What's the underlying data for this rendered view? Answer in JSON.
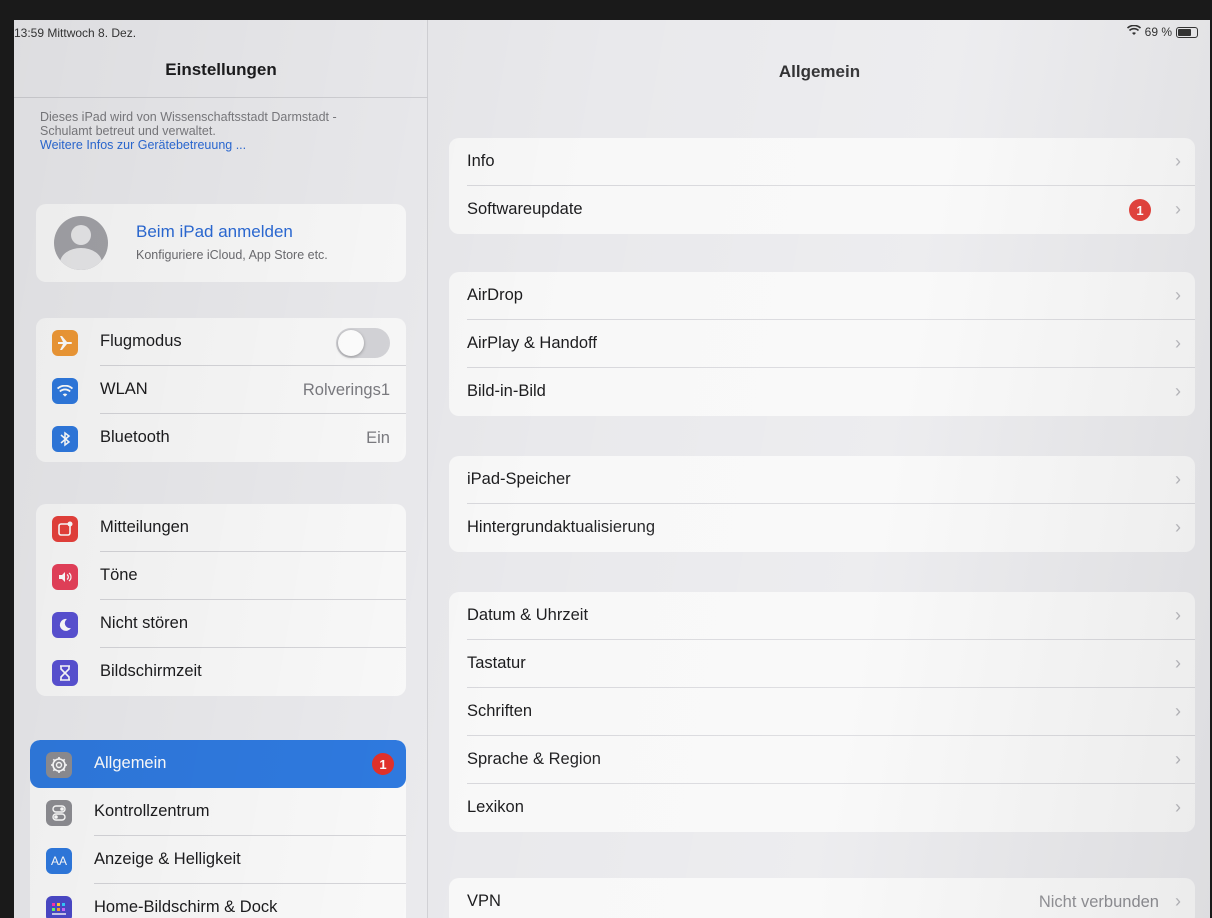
{
  "status": {
    "time": "13:59  Mittwoch 8. Dez.",
    "battery": "69 %"
  },
  "sidebar": {
    "title": "Einstellungen",
    "management": {
      "text": "Dieses iPad wird von Wissenschaftsstadt Darmstadt - Schulamt betreut und verwaltet.",
      "link": "Weitere Infos zur Gerätebetreuung ..."
    },
    "profile": {
      "name": "Beim iPad anmelden",
      "sub": "Konfiguriere iCloud, App Store etc."
    },
    "group1": [
      {
        "label": "Flugmodus",
        "value": "",
        "toggle": "off"
      },
      {
        "label": "WLAN",
        "value": "Rolverings1"
      },
      {
        "label": "Bluetooth",
        "value": "Ein"
      }
    ],
    "group2": [
      {
        "label": "Mitteilungen"
      },
      {
        "label": "Töne"
      },
      {
        "label": "Nicht stören"
      },
      {
        "label": "Bildschirmzeit"
      }
    ],
    "group3": [
      {
        "label": "Allgemein",
        "badge": "1"
      },
      {
        "label": "Kontrollzentrum"
      },
      {
        "label": "Anzeige & Helligkeit",
        "icon_text": "AA"
      },
      {
        "label": "Home-Bildschirm & Dock"
      }
    ]
  },
  "detail": {
    "title": "Allgemein",
    "group1": [
      {
        "label": "Info"
      },
      {
        "label": "Softwareupdate",
        "badge": "1"
      }
    ],
    "group2": [
      {
        "label": "AirDrop"
      },
      {
        "label": "AirPlay & Handoff"
      },
      {
        "label": "Bild-in-Bild"
      }
    ],
    "group3": [
      {
        "label": "iPad-Speicher"
      },
      {
        "label": "Hintergrundaktualisierung"
      }
    ],
    "group4": [
      {
        "label": "Datum & Uhrzeit"
      },
      {
        "label": "Tastatur"
      },
      {
        "label": "Schriften"
      },
      {
        "label": "Sprache & Region"
      },
      {
        "label": "Lexikon"
      }
    ],
    "group5": [
      {
        "label": "VPN",
        "value": "Nicht verbunden"
      }
    ]
  },
  "colors": {
    "accent": "#2f7ae0",
    "link": "#2b6ad6",
    "badge": "#e2312a",
    "flugmodus_icon": "#f19a37",
    "wlan_icon": "#2f7ae0",
    "bluetooth_icon": "#2f7ae0",
    "mitteilungen_icon": "#e8413c",
    "toene_icon": "#e8415b",
    "nicht_stoeren_icon": "#5a52d5",
    "bildschirmzeit_icon": "#5a52d5",
    "allgemein_icon": "#8e8e93",
    "kontrollzentrum_icon": "#8e8e93",
    "anzeige_icon": "#2f7ae0",
    "home_icon": "#4b49c9"
  }
}
